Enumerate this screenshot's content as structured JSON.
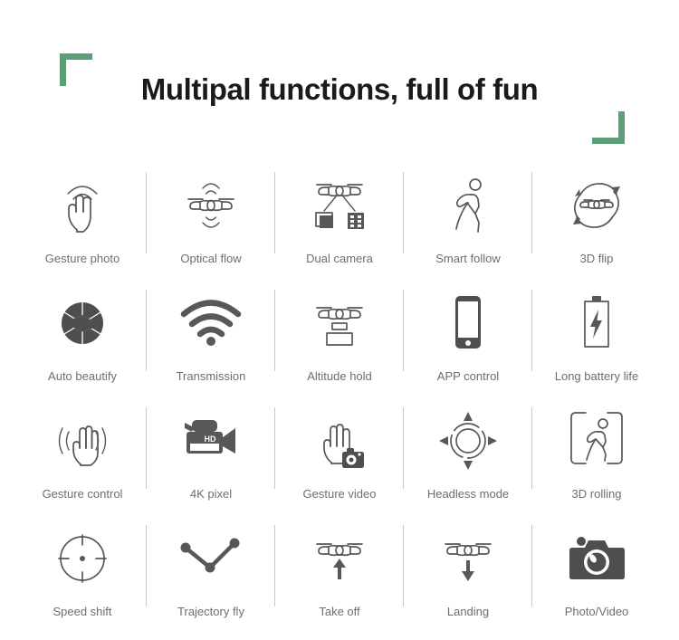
{
  "page": {
    "title": "Multipal functions, full of fun",
    "background_color": "#ffffff",
    "accent_color": "#5d9e78",
    "icon_color": "#58585a",
    "label_color": "#6e6e6e"
  },
  "decorations": [
    {
      "name": "corner-bracket-top-left",
      "color": "#5d9e78"
    },
    {
      "name": "corner-bracket-bottom-right",
      "color": "#5d9e78"
    }
  ],
  "features": {
    "columns": 5,
    "rows": 4,
    "items": [
      {
        "label": "Gesture photo",
        "icon": "hand-two-fingers-waves-icon"
      },
      {
        "label": "Optical flow",
        "icon": "drone-sonar-waves-icon"
      },
      {
        "label": "Dual camera",
        "icon": "drone-photo-video-split-icon"
      },
      {
        "label": "Smart follow",
        "icon": "running-person-icon"
      },
      {
        "label": "3D flip",
        "icon": "drone-circular-arrows-icon"
      },
      {
        "label": "Auto beautify",
        "icon": "camera-aperture-icon"
      },
      {
        "label": "Transmission",
        "icon": "wifi-signal-icon"
      },
      {
        "label": "Altitude hold",
        "icon": "drone-altitude-layers-icon"
      },
      {
        "label": "APP control",
        "icon": "smartphone-icon"
      },
      {
        "label": "Long battery life",
        "icon": "battery-bolt-icon"
      },
      {
        "label": "Gesture control",
        "icon": "open-hand-waves-icon"
      },
      {
        "label": "4K pixel",
        "icon": "camcorder-hd-icon"
      },
      {
        "label": "Gesture video",
        "icon": "hand-camera-icon"
      },
      {
        "label": "Headless mode",
        "icon": "four-direction-dial-icon"
      },
      {
        "label": "3D rolling",
        "icon": "person-in-brackets-icon"
      },
      {
        "label": "Speed shift",
        "icon": "crosshair-target-icon"
      },
      {
        "label": "Trajectory fly",
        "icon": "waypoint-path-icon"
      },
      {
        "label": "Take off",
        "icon": "drone-up-arrow-icon"
      },
      {
        "label": "Landing",
        "icon": "drone-down-arrow-icon"
      },
      {
        "label": "Photo/Video",
        "icon": "camera-filled-icon"
      }
    ]
  },
  "icon_glyph_text": {
    "camcorder_badge": "HD"
  }
}
